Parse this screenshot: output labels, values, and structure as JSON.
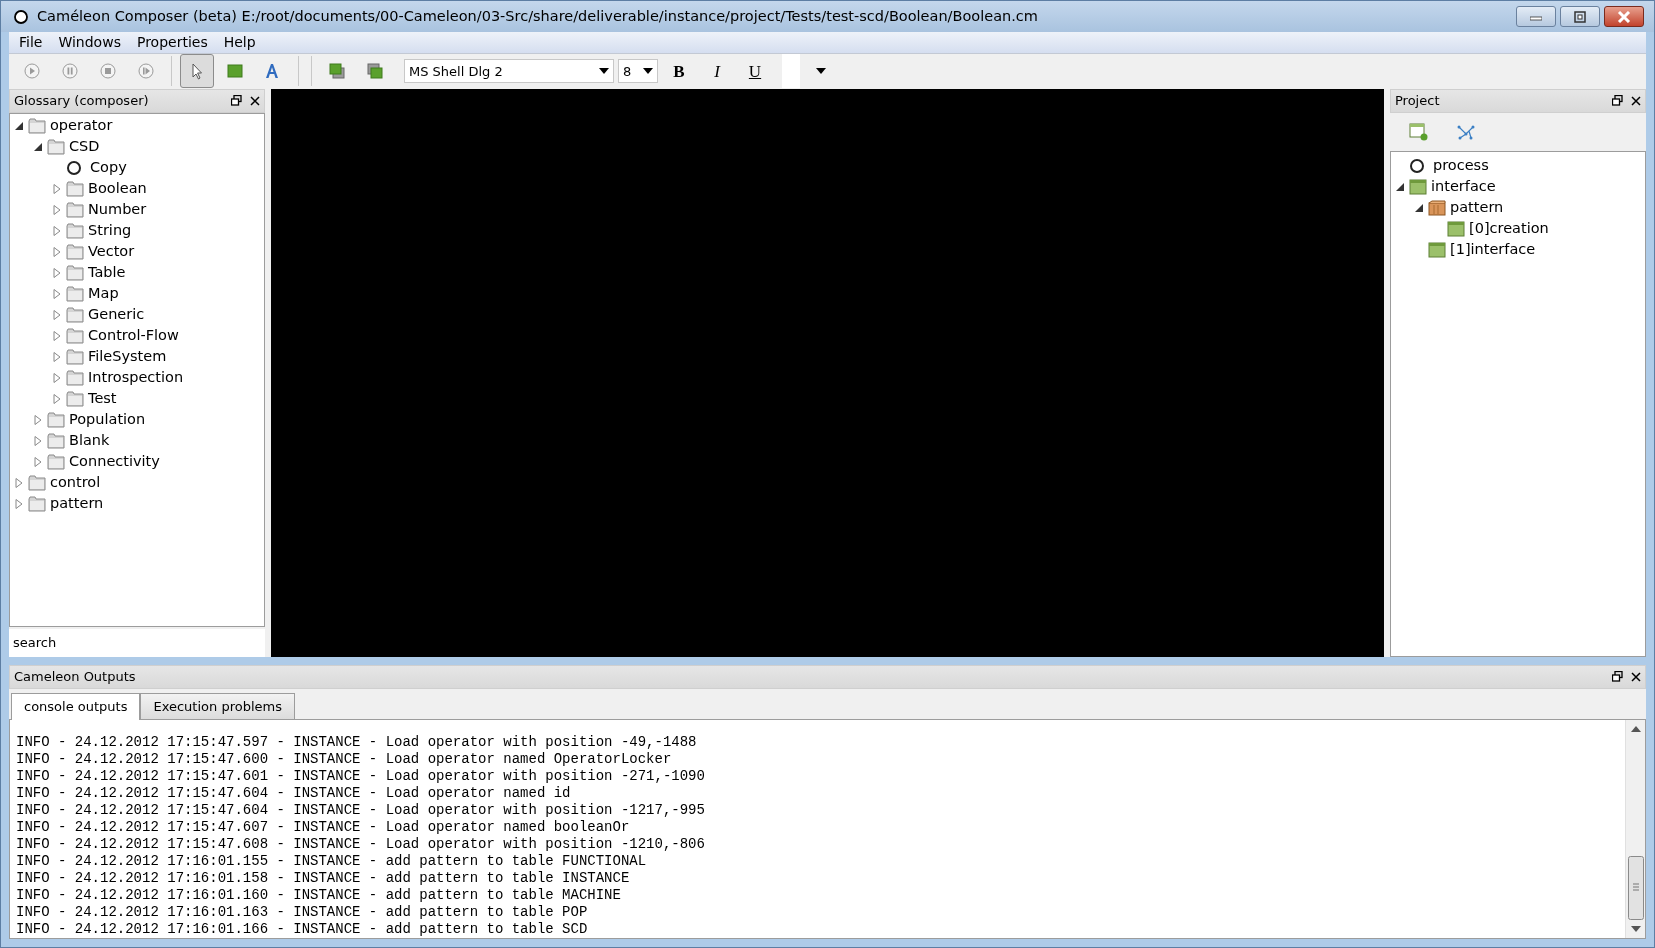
{
  "window": {
    "title": "Caméleon Composer (beta) E:/root/documents/00-Cameleon/03-Src/share/deliverable/instance/project/Tests/test-scd/Boolean/Boolean.cm"
  },
  "menu": [
    "File",
    "Windows",
    "Properties",
    "Help"
  ],
  "toolbar": {
    "tools": [
      {
        "kind": "play",
        "selected": false
      },
      {
        "kind": "pause",
        "selected": false
      },
      {
        "kind": "stop",
        "selected": false
      },
      {
        "kind": "step",
        "selected": false
      },
      {
        "kind": "pointer",
        "selected": true
      },
      {
        "kind": "rectangle",
        "selected": false
      },
      {
        "kind": "text",
        "selected": false
      }
    ],
    "font": "MS Shell Dlg 2",
    "size": "8",
    "format_buttons": [
      "B",
      "I",
      "U"
    ]
  },
  "glossary": {
    "title": "Glossary (composer)",
    "search": "search",
    "items": [
      {
        "label": "operator",
        "kind": "folder",
        "expanded": true,
        "children": [
          {
            "label": "CSD",
            "kind": "folder",
            "expanded": true,
            "children": [
              {
                "label": "Copy",
                "kind": "operator"
              },
              {
                "label": "Boolean",
                "kind": "folder",
                "expanded": false
              },
              {
                "label": "Number",
                "kind": "folder",
                "expanded": false
              },
              {
                "label": "String",
                "kind": "folder",
                "expanded": false
              },
              {
                "label": "Vector",
                "kind": "folder",
                "expanded": false
              },
              {
                "label": "Table",
                "kind": "folder",
                "expanded": false
              },
              {
                "label": "Map",
                "kind": "folder",
                "expanded": false
              },
              {
                "label": "Generic",
                "kind": "folder",
                "expanded": false
              },
              {
                "label": "Control-Flow",
                "kind": "folder",
                "expanded": false
              },
              {
                "label": "FileSystem",
                "kind": "folder",
                "expanded": false
              },
              {
                "label": "Introspection",
                "kind": "folder",
                "expanded": false
              },
              {
                "label": "Test",
                "kind": "folder",
                "expanded": false
              }
            ]
          },
          {
            "label": "Population",
            "kind": "folder",
            "expanded": false
          },
          {
            "label": "Blank",
            "kind": "folder",
            "expanded": false
          },
          {
            "label": "Connectivity",
            "kind": "folder",
            "expanded": false
          }
        ]
      },
      {
        "label": "control",
        "kind": "folder",
        "expanded": false
      },
      {
        "label": "pattern",
        "kind": "folder",
        "expanded": false
      }
    ]
  },
  "project": {
    "title": "Project",
    "items": [
      {
        "label": "process",
        "kind": "operator"
      },
      {
        "label": "interface",
        "kind": "interface",
        "expanded": true,
        "children": [
          {
            "label": "pattern",
            "kind": "pattern",
            "expanded": true,
            "children": [
              {
                "label": "[0]creation",
                "kind": "interface"
              }
            ]
          },
          {
            "label": "[1]interface",
            "kind": "interface"
          }
        ]
      }
    ]
  },
  "outputs": {
    "title": "Cameleon Outputs",
    "tabs": [
      {
        "label": "console outputs",
        "selected": true
      },
      {
        "label": "Execution problems",
        "selected": false
      }
    ],
    "lines": [
      "INFO - 24.12.2012 17:15:47.597 - INSTANCE - Load operator with position -49,-1488",
      "INFO - 24.12.2012 17:15:47.600 - INSTANCE - Load operator named OperatorLocker",
      "INFO - 24.12.2012 17:15:47.601 - INSTANCE - Load operator with position -271,-1090",
      "INFO - 24.12.2012 17:15:47.604 - INSTANCE - Load operator named id",
      "INFO - 24.12.2012 17:15:47.604 - INSTANCE - Load operator with position -1217,-995",
      "INFO - 24.12.2012 17:15:47.607 - INSTANCE - Load operator named booleanOr",
      "INFO - 24.12.2012 17:15:47.608 - INSTANCE - Load operator with position -1210,-806",
      "INFO - 24.12.2012 17:16:01.155 - INSTANCE - add pattern to table FUNCTIONAL",
      "INFO - 24.12.2012 17:16:01.158 - INSTANCE - add pattern to table INSTANCE",
      "INFO - 24.12.2012 17:16:01.160 - INSTANCE - add pattern to table MACHINE",
      "INFO - 24.12.2012 17:16:01.163 - INSTANCE - add pattern to table POP",
      "INFO - 24.12.2012 17:16:01.166 - INSTANCE - add pattern to table SCD"
    ]
  }
}
